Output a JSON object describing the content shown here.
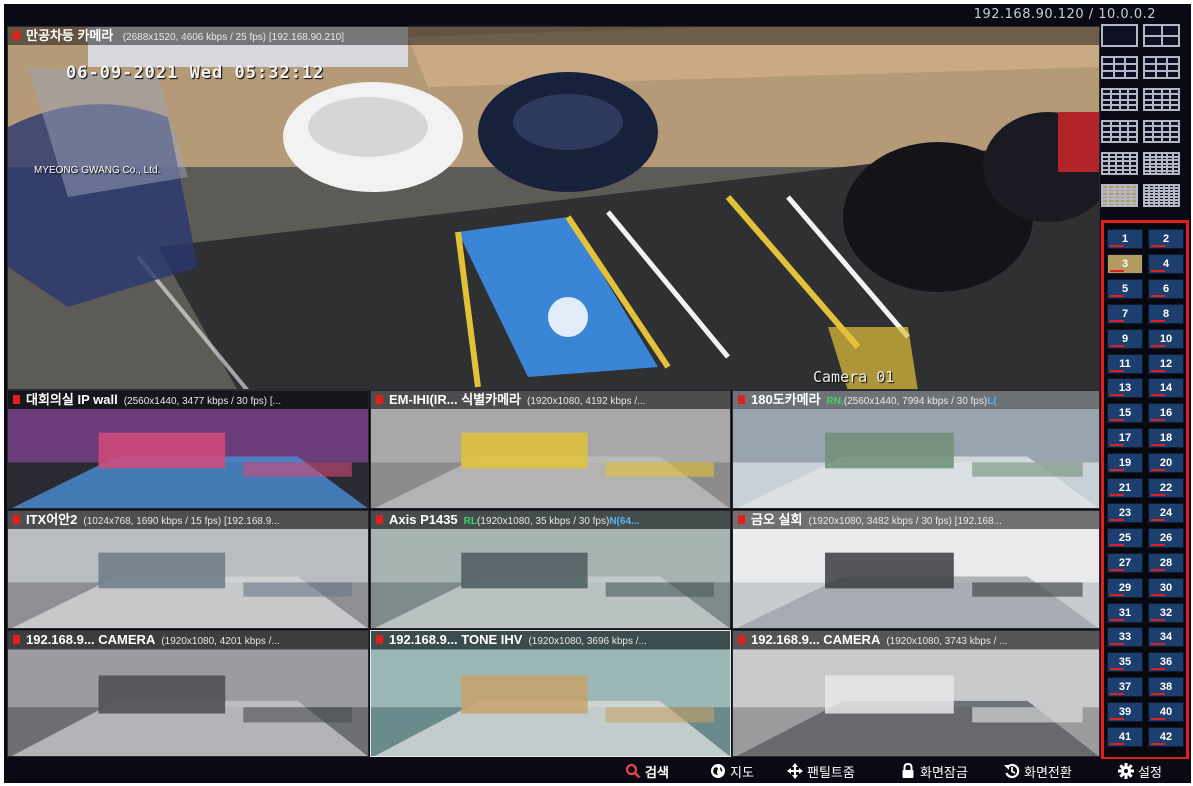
{
  "header": {
    "ip": "192.168.90.120 / 10.0.0.2"
  },
  "main_camera": {
    "name": "만공차등 카메라",
    "info": "(2688x1520, 4606 kbps / 25 fps) [192.168.90.210]",
    "datetime": "06-09-2021 Wed 05:32:12",
    "watermark": "MYEONG GWANG Co., Ltd.",
    "osd_label": "Camera 01"
  },
  "tiles": [
    {
      "name": "대회의실 IP wall",
      "tag": "",
      "info": "(2560x1440, 3477 kbps / 30 fps) [...",
      "tag2": ""
    },
    {
      "name": "EM-IHI(IR... 식별카메라",
      "tag": "",
      "info": "(1920x1080, 4192 kbps /...",
      "tag2": ""
    },
    {
      "name": "180도카메라",
      "tag": "RN,",
      "info": "(2560x1440, 7994 kbps / 30 fps)",
      "tag2": "L("
    },
    {
      "name": "ITX어안2",
      "tag": "",
      "info": "(1024x768, 1690 kbps / 15 fps) [192.168.9...",
      "tag2": ""
    },
    {
      "name": "Axis P1435",
      "tag": "RL",
      "info": "(1920x1080, 35 kbps / 30 fps)",
      "tag2": "N(64..."
    },
    {
      "name": "금오 실회",
      "tag": "",
      "info": "(1920x1080, 3482 kbps / 30 fps) [192.168...",
      "tag2": ""
    },
    {
      "name": "192.168.9... CAMERA",
      "tag": "",
      "info": "(1920x1080, 4201 kbps /...",
      "tag2": ""
    },
    {
      "name": "192.168.9... TONE IHV",
      "tag": "",
      "info": "(1920x1080, 3696 kbps /...",
      "tag2": ""
    },
    {
      "name": "192.168.9... CAMERA",
      "tag": "",
      "info": "(1920x1080, 3743 kbps / ...",
      "tag2": ""
    }
  ],
  "layouts": [
    "1x1",
    "2x2",
    "1+5",
    "3x3",
    "1+7",
    "1+9",
    "1+12",
    "4x4",
    "5x5",
    "6x6",
    "1+33",
    "7x7"
  ],
  "active_layout": "1+33",
  "cameras": [
    "1",
    "2",
    "3",
    "4",
    "5",
    "6",
    "7",
    "8",
    "9",
    "10",
    "11",
    "12",
    "13",
    "14",
    "15",
    "16",
    "17",
    "18",
    "19",
    "20",
    "21",
    "22",
    "23",
    "24",
    "25",
    "26",
    "27",
    "28",
    "29",
    "30",
    "31",
    "32",
    "33",
    "34",
    "35",
    "36",
    "37",
    "38",
    "39",
    "40",
    "41",
    "42"
  ],
  "active_camera": "3",
  "toolbar": [
    {
      "label": "검색",
      "icon": "search-icon"
    },
    {
      "label": "지도",
      "icon": "globe-icon"
    },
    {
      "label": "팬틸트줌",
      "icon": "move-arrows-icon"
    },
    {
      "label": "화면잠금",
      "icon": "lock-icon"
    },
    {
      "label": "화면전환",
      "icon": "switch-screen-icon"
    },
    {
      "label": "설정",
      "icon": "gear-icon"
    }
  ],
  "colors": {
    "accent_red": "#e41d1d",
    "cam_button": "#1d3f6d",
    "active_gold": "#b39b62",
    "search_icon": "#e04848"
  }
}
